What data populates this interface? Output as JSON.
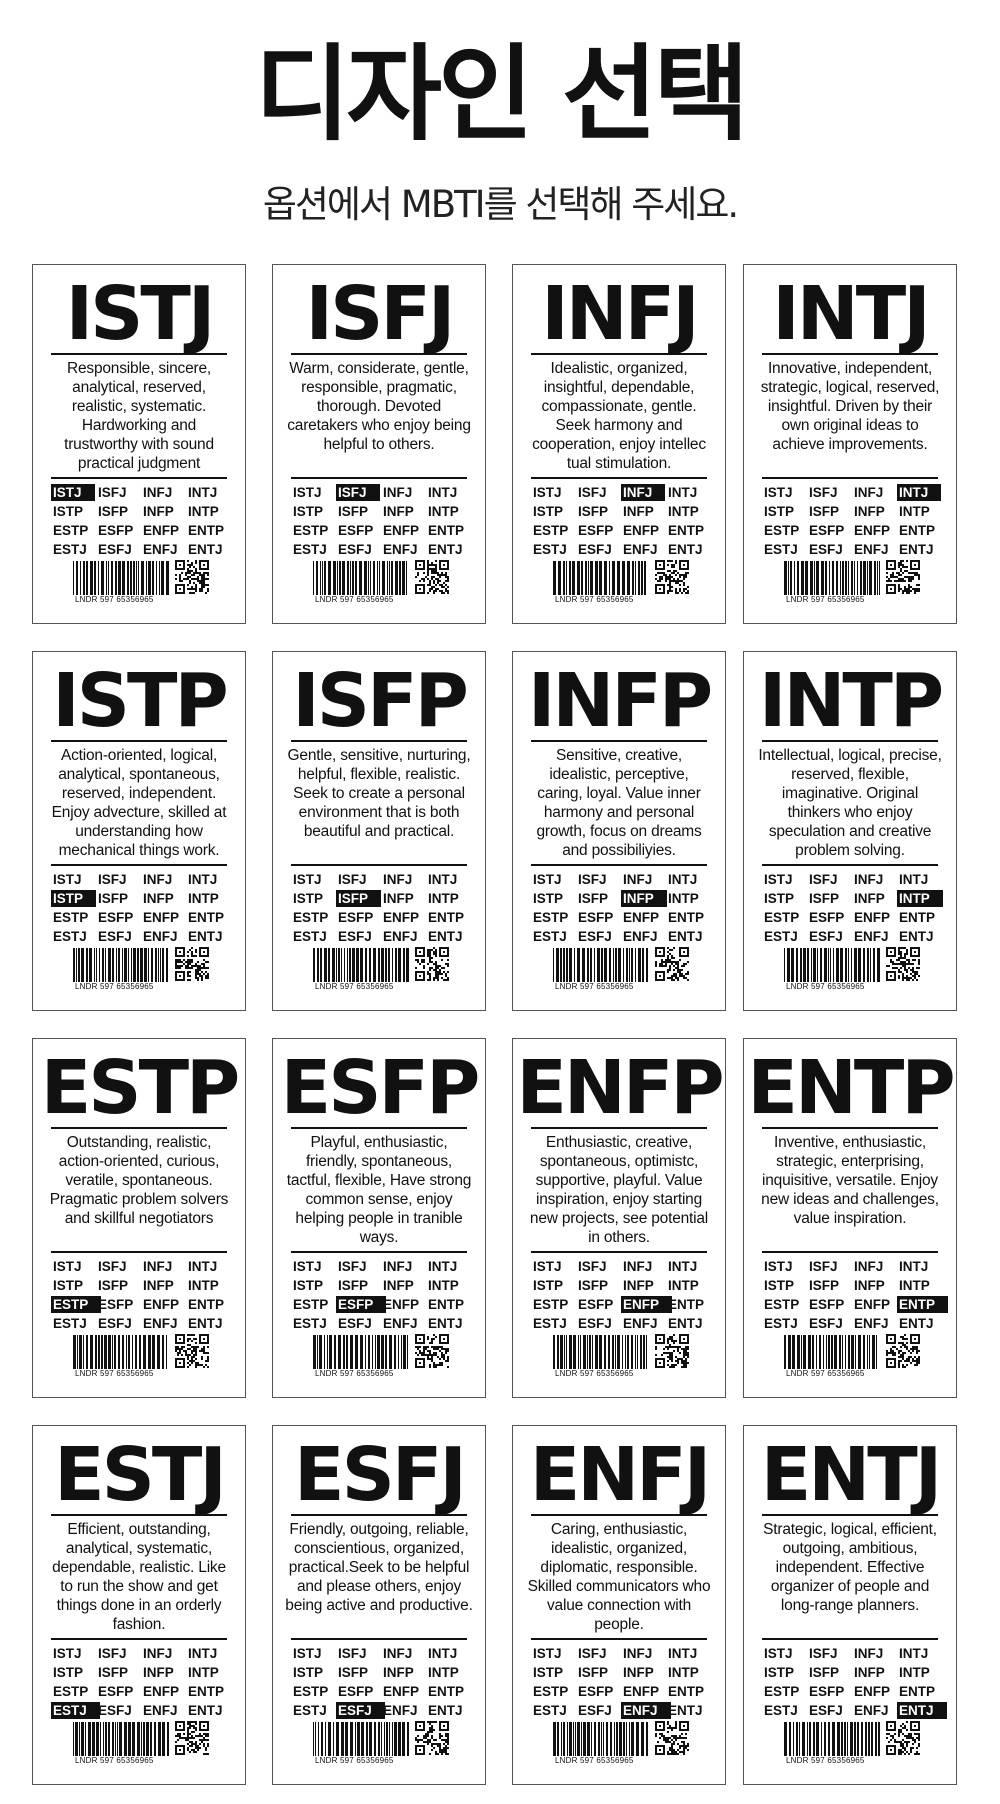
{
  "header": {
    "title": "디자인 선택",
    "subtitle": "옵션에서 MBTI를 선택해 주세요."
  },
  "type_options": [
    [
      "ISTJ",
      "ISFJ",
      "INFJ",
      "INTJ"
    ],
    [
      "ISTP",
      "ISFP",
      "INFP",
      "INTP"
    ],
    [
      "ESTP",
      "ESFP",
      "ENFP",
      "ENTP"
    ],
    [
      "ESTJ",
      "ESFJ",
      "ENFJ",
      "ENTJ"
    ]
  ],
  "cards": [
    {
      "type": "ISTJ",
      "selected": "ISTJ",
      "serial": "LNDR 597 65356965",
      "description": "Responsible, sincere, analytical, reserved, realistic, systematic. Hardworking and trustworthy with sound practical judgment"
    },
    {
      "type": "ISFJ",
      "selected": "ISFJ",
      "serial": "LNDR 597 65356965",
      "description": "Warm, considerate, gentle, responsible, pragmatic, thorough. Devoted caretakers who enjoy being helpful to others."
    },
    {
      "type": "INFJ",
      "selected": "INFJ",
      "serial": "LNDR 597 65356965",
      "description": "Idealistic, organized, insightful, dependable, compassionate, gentle. Seek harmony and cooperation, enjoy intellec tual stimulation."
    },
    {
      "type": "INTJ",
      "selected": "INTJ",
      "serial": "LNDR 597 65356965",
      "description": "Innovative, independent, strategic, logical, reserved, insightful. Driven by their own original ideas to achieve improvements."
    },
    {
      "type": "ISTP",
      "selected": "ISTP",
      "serial": "LNDR 597 65356965",
      "description": "Action-oriented, logical, analytical, spontaneous, reserved, independent. Enjoy advecture, skilled at understanding how mechanical things work."
    },
    {
      "type": "ISFP",
      "selected": "ISFP",
      "serial": "LNDR 597 65356965",
      "description": "Gentle, sensitive, nurturing, helpful, flexible, realistic. Seek to create a personal environment that is both beautiful and practical."
    },
    {
      "type": "INFP",
      "selected": "INFP",
      "serial": "LNDR 597 65356965",
      "description": "Sensitive, creative, idealistic, perceptive, caring, loyal. Value inner harmony  and personal growth, focus on dreams and possibiliyies."
    },
    {
      "type": "INTP",
      "selected": "INTP",
      "serial": "LNDR 597 65356965",
      "description": "Intellectual, logical, precise, reserved, flexible, imaginative. Original thinkers who enjoy speculation and creative problem solving."
    },
    {
      "type": "ESTP",
      "selected": "ESTP",
      "serial": "LNDR 597 65356965",
      "description": "Outstanding, realistic, action-oriented, curious, veratile, spontaneous. Pragmatic problem solvers and skillful negotiators"
    },
    {
      "type": "ESFP",
      "selected": "ESFP",
      "serial": "LNDR 597 65356965",
      "description": "Playful, enthusiastic, friendly, spontaneous, tactful, flexible, Have strong common sense, enjoy helping people in tranible ways."
    },
    {
      "type": "ENFP",
      "selected": "ENFP",
      "serial": "LNDR 597 65356965",
      "description": "Enthusiastic, creative, spontaneous, optimistc, supportive, playful. Value inspiration, enjoy starting new projects, see potential in others."
    },
    {
      "type": "ENTP",
      "selected": "ENTP",
      "serial": "LNDR 597 65356965",
      "description": "Inventive, enthusiastic, strategic, enterprising, inquisitive, versatile. Enjoy new ideas and challenges, value inspiration."
    },
    {
      "type": "ESTJ",
      "selected": "ESTJ",
      "serial": "LNDR 597 65356965",
      "description": "Efficient, outstanding, analytical, systematic, dependable, realistic. Like to run the show and get things done in an orderly fashion."
    },
    {
      "type": "ESFJ",
      "selected": "ESFJ",
      "serial": "LNDR 597 65356965",
      "description": "Friendly, outgoing, reliable, conscientious, organized, practical.Seek to be helpful and please others, enjoy being active and productive."
    },
    {
      "type": "ENFJ",
      "selected": "ENFJ",
      "serial": "LNDR 597 65356965",
      "description": "Caring, enthusiastic, idealistic, organized, diplomatic, responsible. Skilled communicators who value connection with people."
    },
    {
      "type": "ENTJ",
      "selected": "ENTJ",
      "serial": "LNDR 597 65356965",
      "description": "Strategic, logical, efficient, outgoing, ambitious, independent. Effective organizer of people and long-range planners."
    }
  ]
}
